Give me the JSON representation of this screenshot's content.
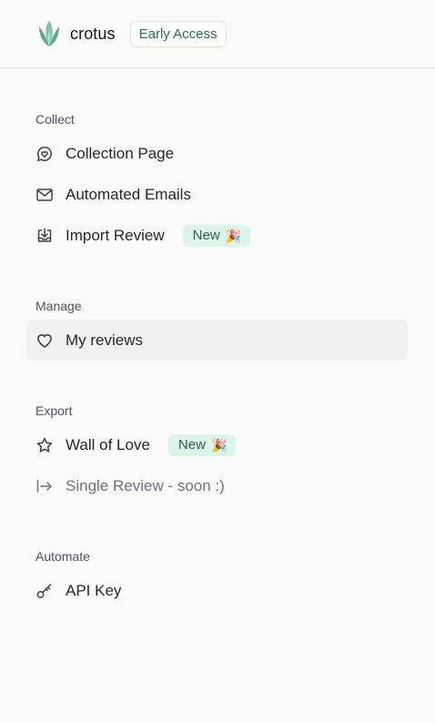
{
  "header": {
    "brand": "crotus",
    "badge": "Early Access"
  },
  "sections": {
    "collect": {
      "title": "Collect",
      "items": [
        {
          "label": "Collection Page",
          "icon": "chat-heart-icon"
        },
        {
          "label": "Automated Emails",
          "icon": "mail-icon"
        },
        {
          "label": "Import Review",
          "icon": "import-icon",
          "badge": "New",
          "badge_emoji": "🎉"
        }
      ]
    },
    "manage": {
      "title": "Manage",
      "items": [
        {
          "label": "My reviews",
          "icon": "heart-icon",
          "active": true
        }
      ]
    },
    "export": {
      "title": "Export",
      "items": [
        {
          "label": "Wall of Love",
          "icon": "star-icon",
          "badge": "New",
          "badge_emoji": "🎉"
        },
        {
          "label": "Single Review - soon :)",
          "icon": "arrow-right-to-line-icon",
          "disabled": true
        }
      ]
    },
    "automate": {
      "title": "Automate",
      "items": [
        {
          "label": "API Key",
          "icon": "key-icon"
        }
      ]
    }
  },
  "colors": {
    "background": "#fafafa",
    "brand_green": "#2f6b58",
    "badge_bg": "#dcf5ea",
    "active_bg": "#f1f1f2"
  }
}
